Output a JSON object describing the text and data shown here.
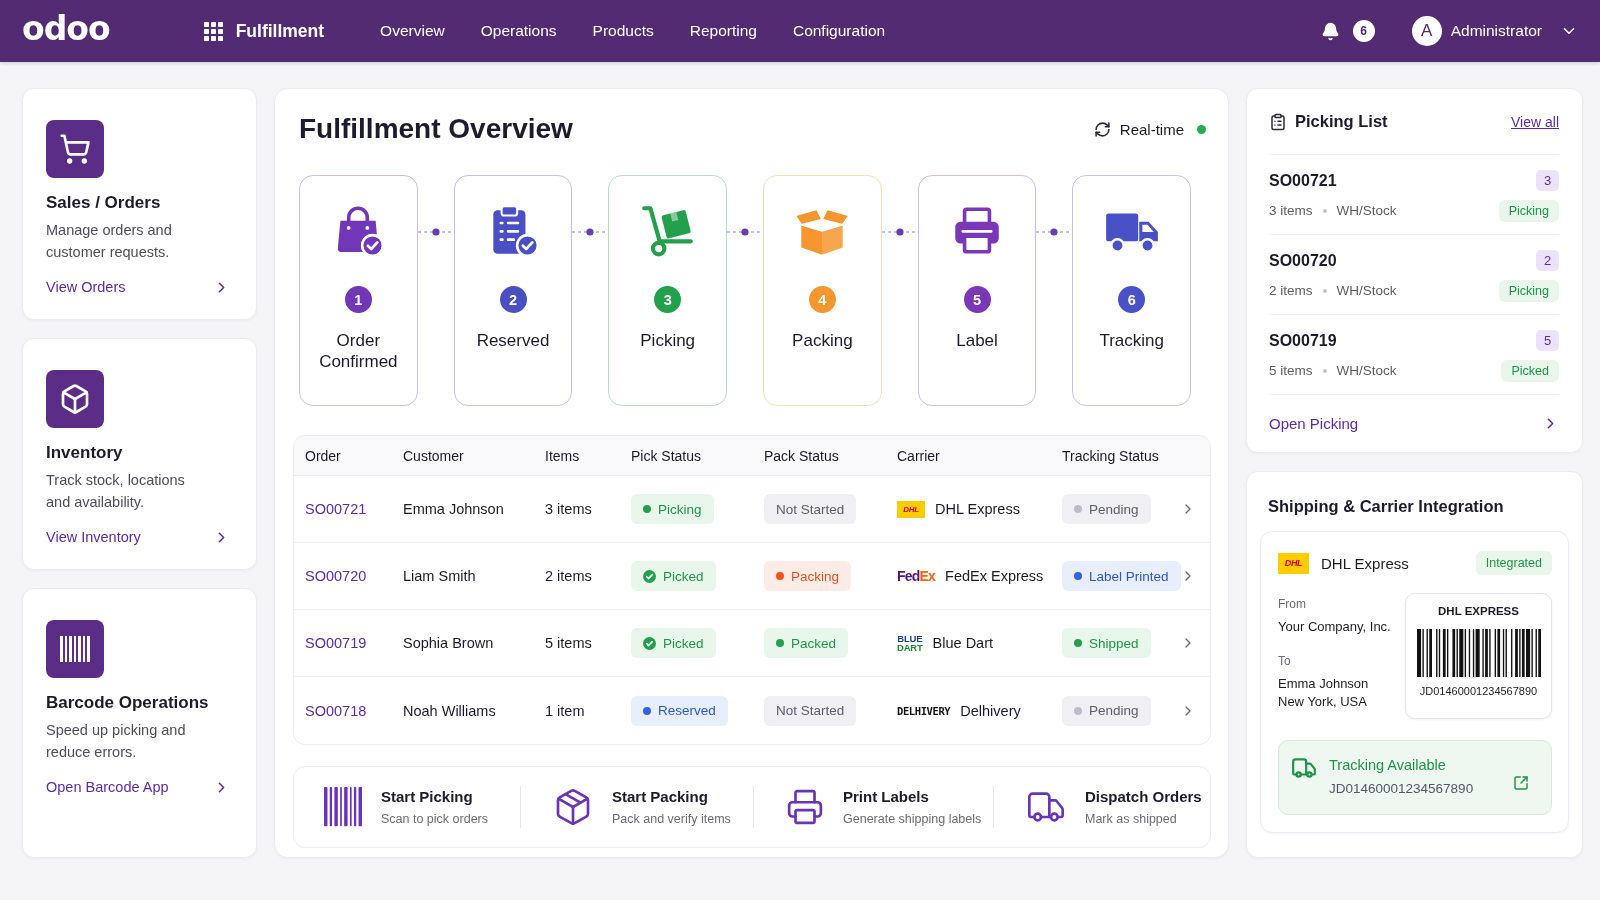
{
  "header": {
    "logo": "odoo",
    "app_name": "Fulfillment",
    "nav": [
      "Overview",
      "Operations",
      "Products",
      "Reporting",
      "Configuration"
    ],
    "notification_count": "6",
    "user": {
      "initial": "A",
      "name": "Administrator"
    }
  },
  "quick_links": [
    {
      "kind": "cart",
      "title": "Sales / Orders",
      "description": "Manage orders and customer requests.",
      "link": "View Orders"
    },
    {
      "kind": "cube",
      "title": "Inventory",
      "description": "Track stock, locations and availability.",
      "link": "View Inventory"
    },
    {
      "kind": "barcode",
      "title": "Barcode Operations",
      "description": "Speed up picking and reduce errors.",
      "link": "Open Barcode App"
    }
  ],
  "overview": {
    "title": "Fulfillment Overview",
    "realtime": {
      "label": "Real-time",
      "live": true
    },
    "steps": [
      {
        "kind": "bag",
        "number": "1",
        "label": "Order Confirmed",
        "color": "#7236b8"
      },
      {
        "kind": "clipboard",
        "number": "2",
        "label": "Reserved",
        "color": "#4a4fc4"
      },
      {
        "kind": "hand_truck",
        "number": "3",
        "label": "Picking",
        "color": "#22a04b"
      },
      {
        "kind": "open_box",
        "number": "4",
        "label": "Packing",
        "color": "#f5962f"
      },
      {
        "kind": "printer",
        "number": "5",
        "label": "Label",
        "color": "#7a38b8"
      },
      {
        "kind": "truck",
        "number": "6",
        "label": "Tracking",
        "color": "#4851c6"
      }
    ],
    "table": {
      "columns": [
        "Order",
        "Customer",
        "Items",
        "Pick Status",
        "Pack Status",
        "Carrier",
        "Tracking Status"
      ],
      "rows": [
        {
          "order": "SO00721",
          "customer": "Emma Johnson",
          "items": "3 items",
          "pick_status": {
            "label": "Picking",
            "kind": "success"
          },
          "pack_status": {
            "label": "Not Started",
            "kind": "idle"
          },
          "carrier": {
            "kind": "dhl",
            "logo": [
              "DHL"
            ],
            "name": "DHL Express"
          },
          "tracking_status": {
            "label": "Pending",
            "kind": "pending"
          }
        },
        {
          "order": "SO00720",
          "customer": "Liam Smith",
          "items": "2 items",
          "pick_status": {
            "label": "Picked",
            "kind": "complete"
          },
          "pack_status": {
            "label": "Packing",
            "kind": "warning"
          },
          "carrier": {
            "kind": "fedex",
            "logo": [
              "Fed",
              "Ex"
            ],
            "name": "FedEx Express"
          },
          "tracking_status": {
            "label": "Label Printed",
            "kind": "info"
          }
        },
        {
          "order": "SO00719",
          "customer": "Sophia Brown",
          "items": "5 items",
          "pick_status": {
            "label": "Picked",
            "kind": "complete"
          },
          "pack_status": {
            "label": "Packed",
            "kind": "success"
          },
          "carrier": {
            "kind": "bluedart",
            "logo": [
              "BLUE",
              "DART"
            ],
            "name": "Blue Dart"
          },
          "tracking_status": {
            "label": "Shipped",
            "kind": "success"
          }
        },
        {
          "order": "SO00718",
          "customer": "Noah Williams",
          "items": "1 item",
          "pick_status": {
            "label": "Reserved",
            "kind": "info"
          },
          "pack_status": {
            "label": "Not Started",
            "kind": "idle"
          },
          "carrier": {
            "kind": "delhivery",
            "logo": [
              "DELHIVERY"
            ],
            "name": "Delhivery"
          },
          "tracking_status": {
            "label": "Pending",
            "kind": "pending"
          }
        }
      ]
    },
    "actions": [
      {
        "kind": "barcode",
        "title": "Start Picking",
        "subtitle": "Scan to pick orders"
      },
      {
        "kind": "box",
        "title": "Start Packing",
        "subtitle": "Pack and verify items"
      },
      {
        "kind": "printer",
        "title": "Print Labels",
        "subtitle": "Generate shipping labels"
      },
      {
        "kind": "truck",
        "title": "Dispatch Orders",
        "subtitle": "Mark as shipped"
      }
    ]
  },
  "picking_list": {
    "title": "Picking List",
    "view_all": "View all",
    "items": [
      {
        "order": "SO00721",
        "count": "3",
        "items": "3 items",
        "location": "WH/Stock",
        "status": {
          "label": "Picking",
          "kind": "success"
        }
      },
      {
        "order": "SO00720",
        "count": "2",
        "items": "2 items",
        "location": "WH/Stock",
        "status": {
          "label": "Picking",
          "kind": "success"
        }
      },
      {
        "order": "SO00719",
        "count": "5",
        "items": "5 items",
        "location": "WH/Stock",
        "status": {
          "label": "Picked",
          "kind": "success"
        }
      }
    ],
    "footer_link": "Open Picking"
  },
  "shipping": {
    "title": "Shipping & Carrier Integration",
    "carrier": {
      "kind": "dhl",
      "logo": [
        "DHL"
      ],
      "name": "DHL Express",
      "status": "Integrated"
    },
    "from_label": "From",
    "from": "Your Company, Inc.",
    "to_label": "To",
    "to": [
      "Emma Johnson",
      "New York, USA"
    ],
    "label": {
      "title": "DHL EXPRESS",
      "tracking_number": "JD01460001234567890"
    },
    "tracking": {
      "title": "Tracking Available",
      "number": "JD01460001234567890"
    }
  }
}
